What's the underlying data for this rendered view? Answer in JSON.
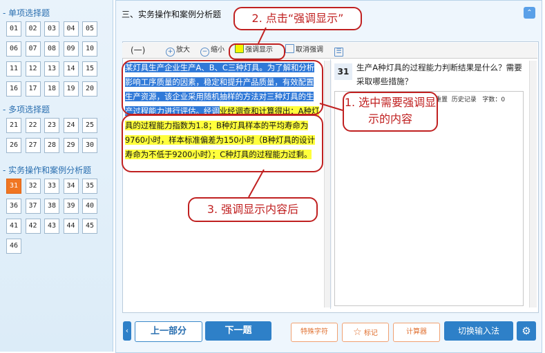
{
  "sidebar": {
    "sections": [
      {
        "title": "- 单项选择题",
        "items": [
          "01",
          "02",
          "03",
          "04",
          "05",
          "06",
          "07",
          "08",
          "09",
          "10",
          "11",
          "12",
          "13",
          "14",
          "15",
          "16",
          "17",
          "18",
          "19",
          "20"
        ]
      },
      {
        "title": "- 多项选择题",
        "items": [
          "21",
          "22",
          "23",
          "24",
          "25",
          "26",
          "27",
          "28",
          "29",
          "30"
        ]
      },
      {
        "title": "- 实务操作和案例分析题",
        "items": [
          "31",
          "32",
          "33",
          "34",
          "35",
          "36",
          "37",
          "38",
          "39",
          "40",
          "41",
          "42",
          "43",
          "44",
          "45",
          "46"
        ]
      }
    ],
    "active_item": "31"
  },
  "header": {
    "title": "三、实务操作和案例分析题",
    "collapse_icon": "double-chevron-up-icon"
  },
  "toolbar": {
    "part_label": "(一)",
    "zoom_in": "放大",
    "zoom_out": "缩小",
    "highlight": "强调显示",
    "cancel_highlight": "取消强调"
  },
  "passage": {
    "selected_text": "某灯具生产企业生产A、B、C三种灯具。为了解和分析影响工序质量的因素，稳定和提升产品质量，有效配置生产资源，该企业采用随机抽样的方法对三种灯具的生产过程能力进行评估。经调",
    "highlighted_text": "业经调查和计算得出：A种灯具的过程能力指数为1.8；B种灯具样本的平均寿命为9760小时，样本标准偏差为150小时（B种灯具的设计寿命为不低于9200小时）；C种灯具的过程能力过剩。"
  },
  "question": {
    "number": "31",
    "text": "生产A种灯具的过程能力判断结果是什么？需要采取哪些措施？"
  },
  "answer_toolbar": {
    "redo": "重置",
    "history": "历史记录",
    "word_count_label": "字数：",
    "word_count": "0"
  },
  "footer": {
    "prev": "上一部分",
    "next": "下一题",
    "special_chars": "特殊字符",
    "mark": "标记",
    "calculator": "计算器",
    "switch_input": "切换输入法"
  },
  "annotations": {
    "step1": "1. 选中需要强调显示的内容",
    "step2": "2. 点击“强调显示”",
    "step3": "3. 强调显示内容后"
  },
  "colors": {
    "accent": "#2e80c8",
    "annotation": "#c02020",
    "active": "#f07622",
    "highlight": "#ffff3c",
    "selection": "#3079d8"
  }
}
